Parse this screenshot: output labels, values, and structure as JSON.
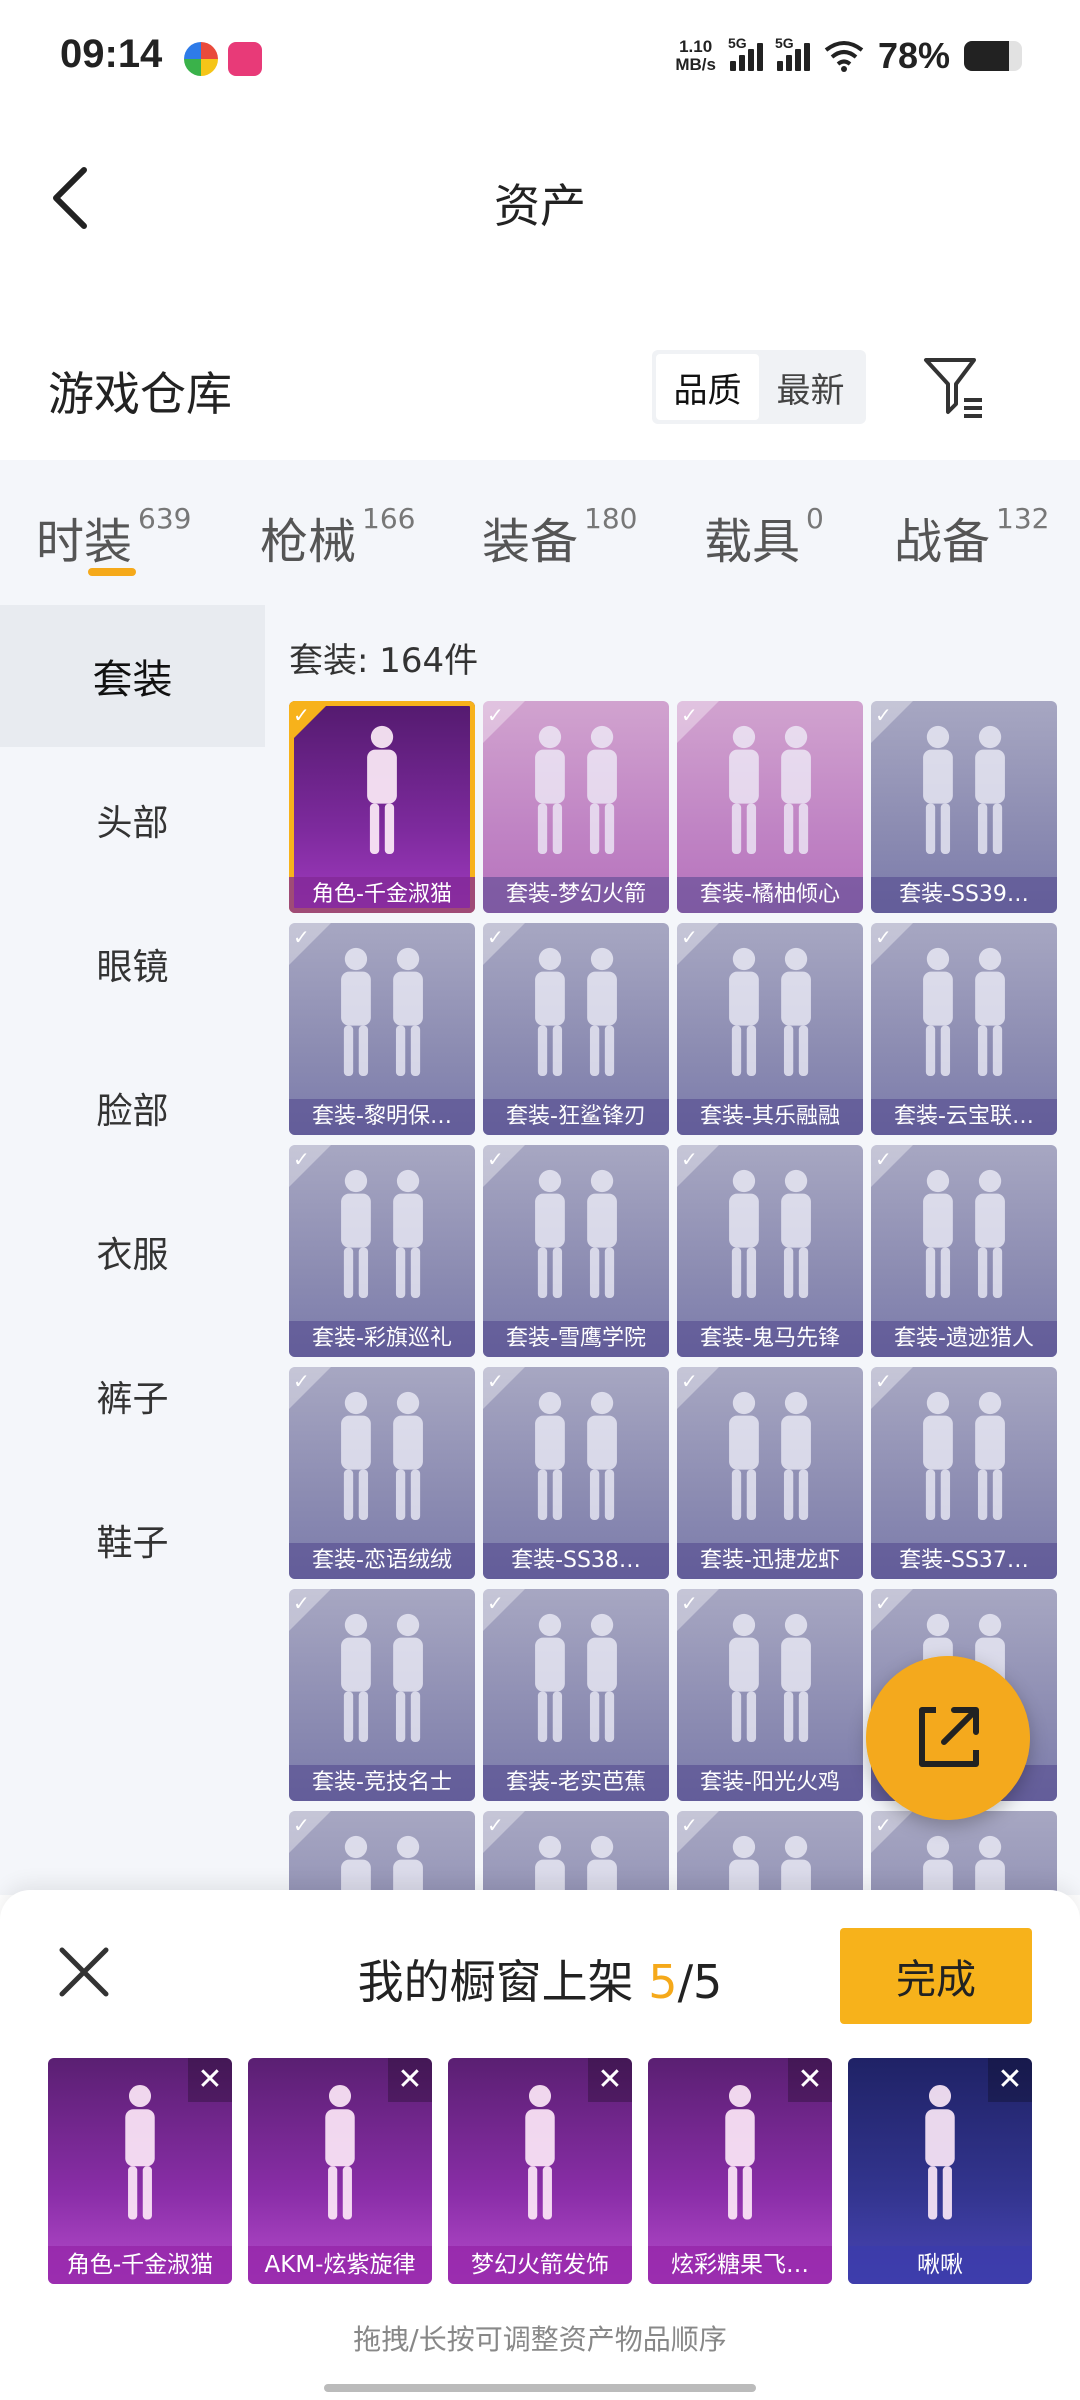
{
  "status_bar": {
    "time": "09:14",
    "net_speed_value": "1.10",
    "net_speed_unit": "MB/s",
    "signal1": "5G",
    "signal2": "5G",
    "battery": "78%",
    "battery_level": 0.78
  },
  "header": {
    "title": "资产"
  },
  "section": {
    "title": "游戏仓库",
    "sort_options": [
      "品质",
      "最新"
    ],
    "sort_selected": "品质"
  },
  "tabs": [
    {
      "label": "时装",
      "count": "639",
      "active": true
    },
    {
      "label": "枪械",
      "count": "166",
      "active": false
    },
    {
      "label": "装备",
      "count": "180",
      "active": false
    },
    {
      "label": "载具",
      "count": "0",
      "active": false
    },
    {
      "label": "战备",
      "count": "132",
      "active": false
    }
  ],
  "sidebar": [
    {
      "label": "套装",
      "active": true
    },
    {
      "label": "头部",
      "active": false
    },
    {
      "label": "眼镜",
      "active": false
    },
    {
      "label": "脸部",
      "active": false
    },
    {
      "label": "衣服",
      "active": false
    },
    {
      "label": "裤子",
      "active": false
    },
    {
      "label": "鞋子",
      "active": false
    }
  ],
  "grid": {
    "count_label": "套装: 164件",
    "items": [
      {
        "label": "角色-千金淑猫",
        "style": "purple",
        "selected": true
      },
      {
        "label": "套装-梦幻火箭",
        "style": "pink",
        "selected": false
      },
      {
        "label": "套装-橘柚倾心",
        "style": "pink",
        "selected": false
      },
      {
        "label": "套装-SS39…",
        "style": "grey",
        "selected": false
      },
      {
        "label": "套装-黎明保…",
        "style": "grey",
        "selected": false
      },
      {
        "label": "套装-狂鲨锋刃",
        "style": "grey",
        "selected": false
      },
      {
        "label": "套装-其乐融融",
        "style": "grey",
        "selected": false
      },
      {
        "label": "套装-云宝联…",
        "style": "grey",
        "selected": false
      },
      {
        "label": "套装-彩旗巡礼",
        "style": "grey",
        "selected": false
      },
      {
        "label": "套装-雪鹰学院",
        "style": "grey",
        "selected": false
      },
      {
        "label": "套装-鬼马先锋",
        "style": "grey",
        "selected": false
      },
      {
        "label": "套装-遗迹猎人",
        "style": "grey",
        "selected": false
      },
      {
        "label": "套装-恋语绒绒",
        "style": "grey",
        "selected": false
      },
      {
        "label": "套装-SS38…",
        "style": "grey",
        "selected": false
      },
      {
        "label": "套装-迅捷龙虾",
        "style": "grey",
        "selected": false
      },
      {
        "label": "套装-SS37…",
        "style": "grey",
        "selected": false
      },
      {
        "label": "套装-竞技名士",
        "style": "grey",
        "selected": false
      },
      {
        "label": "套装-老实芭蕉",
        "style": "grey",
        "selected": false
      },
      {
        "label": "套装-阳光火鸡",
        "style": "grey",
        "selected": false
      },
      {
        "label": "人",
        "style": "grey",
        "selected": false
      },
      {
        "label": "",
        "style": "grey",
        "selected": false
      },
      {
        "label": "",
        "style": "grey",
        "selected": false
      },
      {
        "label": "",
        "style": "grey",
        "selected": false
      },
      {
        "label": "",
        "style": "grey",
        "selected": false
      }
    ]
  },
  "sheet": {
    "title_prefix": "我的橱窗上架 ",
    "current": "5",
    "total": "/5",
    "done_label": "完成",
    "items": [
      {
        "label": "角色-千金淑猫",
        "style": "purple"
      },
      {
        "label": "AKM-炫紫旋律",
        "style": "purple"
      },
      {
        "label": "梦幻火箭发饰",
        "style": "purple"
      },
      {
        "label": "炫彩糖果飞…",
        "style": "purple"
      },
      {
        "label": "啾啾",
        "style": "blue"
      }
    ],
    "remove_glyph": "✕",
    "hint": "拖拽/长按可调整资产物品顺序"
  },
  "colors": {
    "accent": "#f7b21b",
    "tab_indicator": "#f5a91a"
  },
  "icons": {
    "back": "chevron-left-icon",
    "filter": "filter-icon",
    "share": "share-icon",
    "close": "close-icon"
  }
}
